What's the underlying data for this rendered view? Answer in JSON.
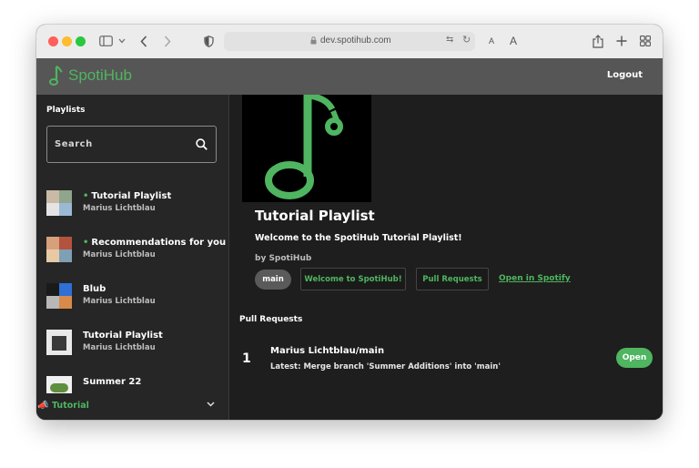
{
  "browser": {
    "url": "dev.spotihub.com",
    "text_size_small": "A",
    "text_size_large": "A"
  },
  "app": {
    "logo": "SpotiHub",
    "logout_label": "Logout",
    "accent_color": "#4fb560"
  },
  "sidebar": {
    "heading": "Playlists",
    "search_placeholder": "Search",
    "items": [
      {
        "title": "Tutorial Playlist",
        "owner": "Marius Lichtblau",
        "marked": true
      },
      {
        "title": "Recommendations for you",
        "owner": "Marius Lichtblau",
        "marked": true
      },
      {
        "title": "Blub",
        "owner": "Marius Lichtblau",
        "marked": false
      },
      {
        "title": "Tutorial Playlist",
        "owner": "Marius Lichtblau",
        "marked": false
      },
      {
        "title": "Summer 22",
        "owner": "",
        "marked": false
      }
    ],
    "footer_label": "Tutorial",
    "dot": "•"
  },
  "playlist": {
    "title": "Tutorial Playlist",
    "description": "Welcome to the SpotiHub Tutorial Playlist!",
    "by": "by SpotiHub",
    "branch": "main",
    "buttons": {
      "welcome": "Welcome to SpotiHub!",
      "pull_requests": "Pull Requests"
    },
    "open_link": "Open in Spotify"
  },
  "pull_requests": {
    "heading": "Pull Requests",
    "items": [
      {
        "number": "1",
        "title": "Marius Lichtblau/main",
        "subtitle": "Latest: Merge branch 'Summer Additions' into 'main'",
        "status": "Open"
      }
    ]
  }
}
